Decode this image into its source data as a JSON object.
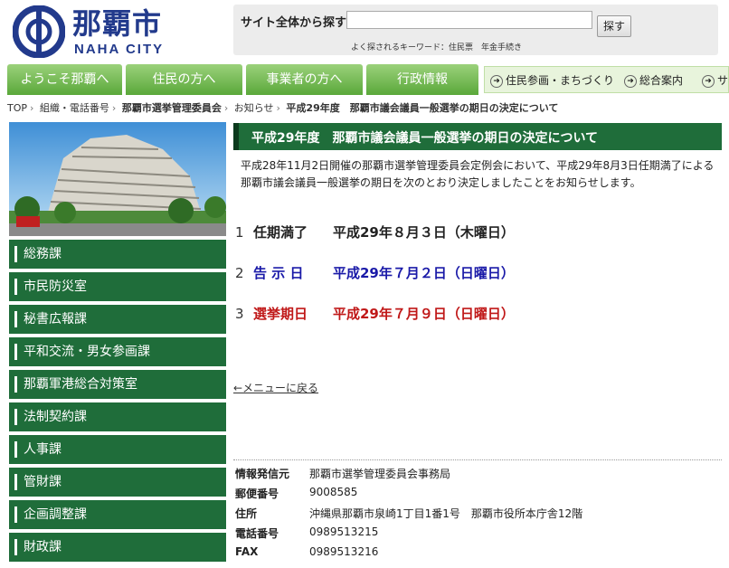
{
  "header": {
    "logo_jp": "那覇市",
    "logo_en": "NAHA CITY",
    "search_label": "サイト全体から探す",
    "search_value": "",
    "search_button": "探す",
    "keywords": "よく探されるキーワード：住民票　年金手続き"
  },
  "nav": {
    "tabs": [
      "ようこそ那覇へ",
      "住民の方へ",
      "事業者の方へ",
      "行政情報"
    ],
    "sub": [
      "住民参画・まちづくり",
      "総合案内",
      "サ"
    ]
  },
  "breadcrumb": [
    "TOP",
    "組織・電話番号",
    "那覇市選挙管理委員会",
    "お知らせ",
    "平成29年度　那覇市議会議員一般選挙の期日の決定について"
  ],
  "sidebar": {
    "items": [
      "総務課",
      "市民防災室",
      "秘書広報課",
      "平和交流・男女参画課",
      "那覇軍港総合対策室",
      "法制契約課",
      "人事課",
      "管財課",
      "企画調整課",
      "財政課"
    ]
  },
  "content": {
    "title": "平成29年度　那覇市議会議員一般選挙の期日の決定について",
    "intro": "平成28年11月2日開催の那覇市選挙管理委員会定例会において、平成29年8月3日任期満了による那覇市議会議員一般選挙の期日を次のとおり決定しましたことをお知らせします。",
    "items": [
      {
        "num": "1",
        "key": "任期満了",
        "value": "平成29年８月３日（木曜日）",
        "color": "#222222"
      },
      {
        "num": "2",
        "key": "告 示 日",
        "value": "平成29年７月２日（日曜日）",
        "color": "#1a1aa8"
      },
      {
        "num": "3",
        "key": "選挙期日",
        "value": "平成29年７月９日（日曜日）",
        "color": "#c01818"
      }
    ],
    "back_link": "←メニューに戻る"
  },
  "info": [
    {
      "key": "情報発信元",
      "value": "那覇市選挙管理委員会事務局"
    },
    {
      "key": "郵便番号",
      "value": "9008585"
    },
    {
      "key": "住所",
      "value": "沖縄県那覇市泉崎1丁目1番1号　那覇市役所本庁舎12階"
    },
    {
      "key": "電話番号",
      "value": "0989513215"
    },
    {
      "key": "FAX",
      "value": "0989513216"
    }
  ],
  "colors": {
    "accent_green": "#1f6d3a",
    "nav_green": "#6db24a",
    "logo_blue": "#223a8c"
  }
}
